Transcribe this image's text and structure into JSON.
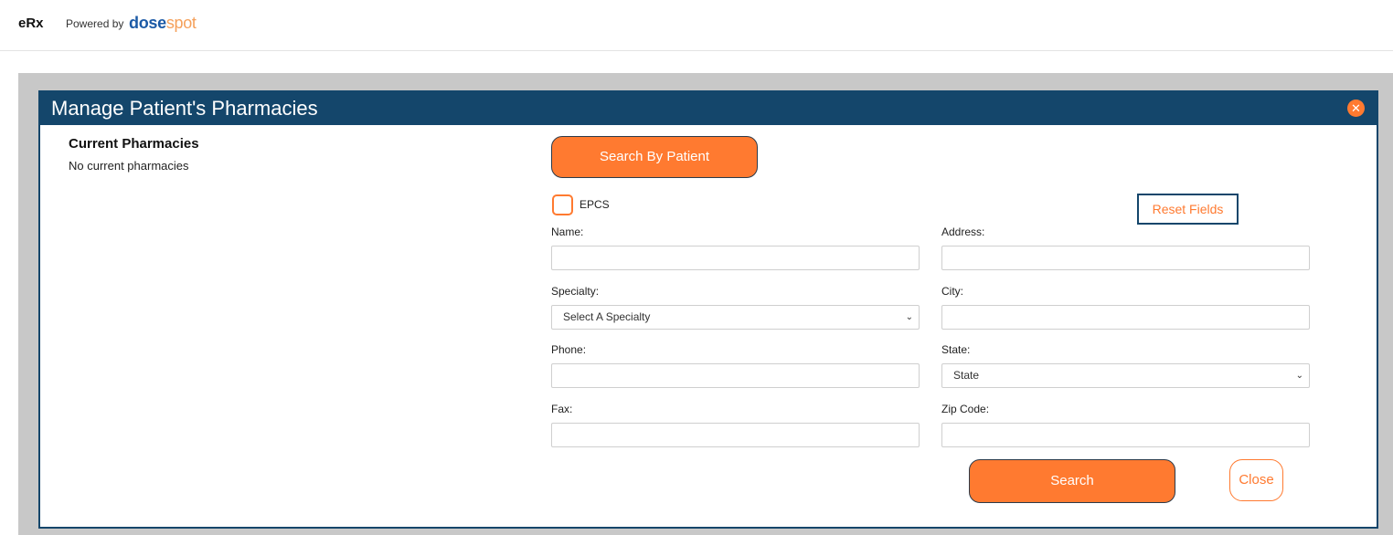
{
  "topbar": {
    "app_title": "eRx",
    "powered_by": "Powered by",
    "brand_part1": "dose",
    "brand_part2": "spot"
  },
  "modal": {
    "title": "Manage Patient's Pharmacies",
    "close_icon": "close-circle-icon",
    "current_pharmacies_title": "Current Pharmacies",
    "current_pharmacies_empty": "No current pharmacies"
  },
  "form": {
    "search_by_patient_label": "Search By Patient",
    "epcs_label": "EPCS",
    "epcs_checked": false,
    "reset_label": "Reset Fields",
    "name_label": "Name:",
    "name_value": "",
    "address_label": "Address:",
    "address_value": "",
    "specialty_label": "Specialty:",
    "specialty_selected": "Select A Specialty",
    "city_label": "City:",
    "city_value": "",
    "phone_label": "Phone:",
    "phone_value": "",
    "state_label": "State:",
    "state_selected": "State",
    "fax_label": "Fax:",
    "fax_value": "",
    "zip_label": "Zip Code:",
    "zip_value": "",
    "search_label": "Search",
    "close_label": "Close"
  },
  "colors": {
    "header": "#14466b",
    "accent": "#ff7a30",
    "overlay": "#c8c8c8",
    "brand_blue": "#1c5aa6",
    "brand_orange": "#f5a05a"
  }
}
